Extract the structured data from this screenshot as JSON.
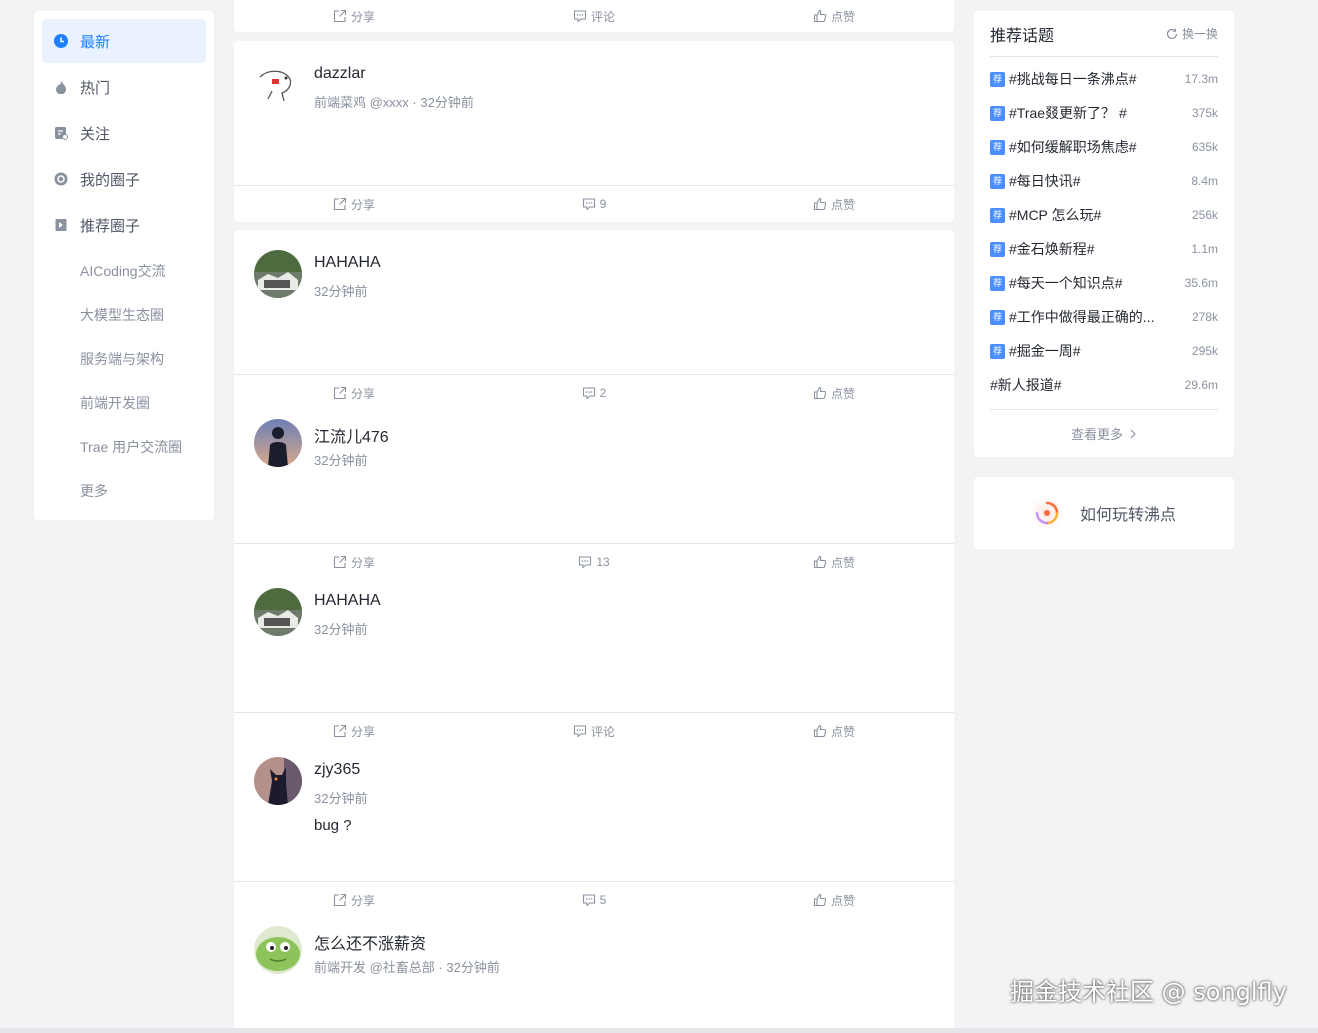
{
  "sidebar": {
    "items": [
      {
        "label": "最新"
      },
      {
        "label": "热门"
      },
      {
        "label": "关注"
      },
      {
        "label": "我的圈子"
      },
      {
        "label": "推荐圈子"
      }
    ],
    "circles": [
      "AICoding交流",
      "大模型生态圈",
      "服务端与架构",
      "前端开发圈",
      "Trae 用户交流圈",
      "更多"
    ]
  },
  "feed": {
    "top_strip": {
      "share": "分享",
      "comment": "评论",
      "like": "点赞"
    },
    "posts": [
      {
        "name": "dazzlar",
        "meta": "前端菜鸡 @xxxx · 32分钟前",
        "content": "",
        "share": "分享",
        "comment": "9",
        "like": "点赞"
      },
      {
        "name": "HAHAHA",
        "meta": "32分钟前",
        "content": "",
        "share": "分享",
        "comment": "2",
        "like": "点赞"
      },
      {
        "name": "江流儿476",
        "meta": "32分钟前",
        "content": "",
        "share": "分享",
        "comment": "13",
        "like": "点赞"
      },
      {
        "name": "HAHAHA",
        "meta": "32分钟前",
        "content": "",
        "share": "分享",
        "comment": "评论",
        "like": "点赞"
      },
      {
        "name": "zjy365",
        "meta": "32分钟前",
        "content": "bug ?",
        "share": "分享",
        "comment": "5",
        "like": "点赞"
      },
      {
        "name": "怎么还不涨薪资",
        "meta": "前端开发 @社畜总部 · 32分钟前",
        "content": "",
        "share": "",
        "comment": "",
        "like": ""
      }
    ]
  },
  "topics": {
    "title": "推荐话题",
    "refresh": "换一换",
    "tag": "荐",
    "items": [
      {
        "name": "#挑战每日一条沸点#",
        "count": "17.3m",
        "tagged": true
      },
      {
        "name": "#Trae叕更新了？ #",
        "count": "375k",
        "tagged": true
      },
      {
        "name": "#如何缓解职场焦虑#",
        "count": "635k",
        "tagged": true
      },
      {
        "name": "#每日快讯#",
        "count": "8.4m",
        "tagged": true
      },
      {
        "name": "#MCP 怎么玩#",
        "count": "256k",
        "tagged": true
      },
      {
        "name": "#金石焕新程#",
        "count": "1.1m",
        "tagged": true
      },
      {
        "name": "#每天一个知识点#",
        "count": "35.6m",
        "tagged": true
      },
      {
        "name": "#工作中做得最正确的...",
        "count": "278k",
        "tagged": true
      },
      {
        "name": "#掘金一周#",
        "count": "295k",
        "tagged": true
      },
      {
        "name": "#新人报道#",
        "count": "29.6m",
        "tagged": false
      }
    ],
    "more": "查看更多"
  },
  "howto": {
    "label": "如何玩转沸点"
  },
  "watermark": "掘金技术社区 @ songlfly",
  "colors": {
    "accent": "#1e80ff",
    "tag": "#4a8eff",
    "muted": "#8a919f",
    "bg": "#f2f3f5"
  }
}
